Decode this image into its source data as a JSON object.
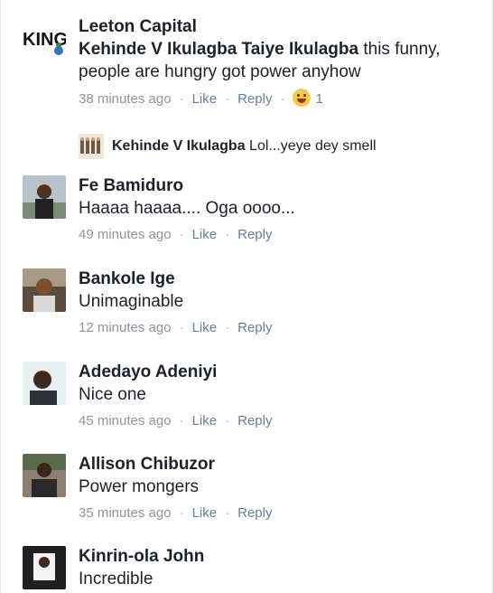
{
  "comments": [
    {
      "name": "Leeton Capital",
      "tag": "Kehinde V Ikulagba Taiye Ikulagba",
      "text": " this funny, people are hungry got power anyhow",
      "time": "38 minutes ago",
      "like": "Like",
      "reply": "Reply",
      "reaction_count": "1",
      "logo_text": "KING",
      "reply_preview": {
        "name": "Kehinde V Ikulagba",
        "text": " Lol...yeye dey smell"
      }
    },
    {
      "name": "Fe Bamiduro",
      "text": "Haaaa haaaa.... Oga oooo...",
      "time": "49 minutes ago",
      "like": "Like",
      "reply": "Reply"
    },
    {
      "name": "Bankole Ige",
      "text": "Unimaginable",
      "time": "12 minutes ago",
      "like": "Like",
      "reply": "Reply"
    },
    {
      "name": "Adedayo Adeniyi",
      "text": "Nice one",
      "time": "45 minutes ago",
      "like": "Like",
      "reply": "Reply"
    },
    {
      "name": "Allison Chibuzor",
      "text": "Power mongers",
      "time": "35 minutes ago",
      "like": "Like",
      "reply": "Reply"
    },
    {
      "name": "Kinrin-ola John",
      "text": "Incredible"
    }
  ],
  "separator": "·",
  "colors": {
    "name": "#1d2129",
    "meta": "#90949c",
    "link": "#6b7b99",
    "emoji": "#f7c948"
  }
}
